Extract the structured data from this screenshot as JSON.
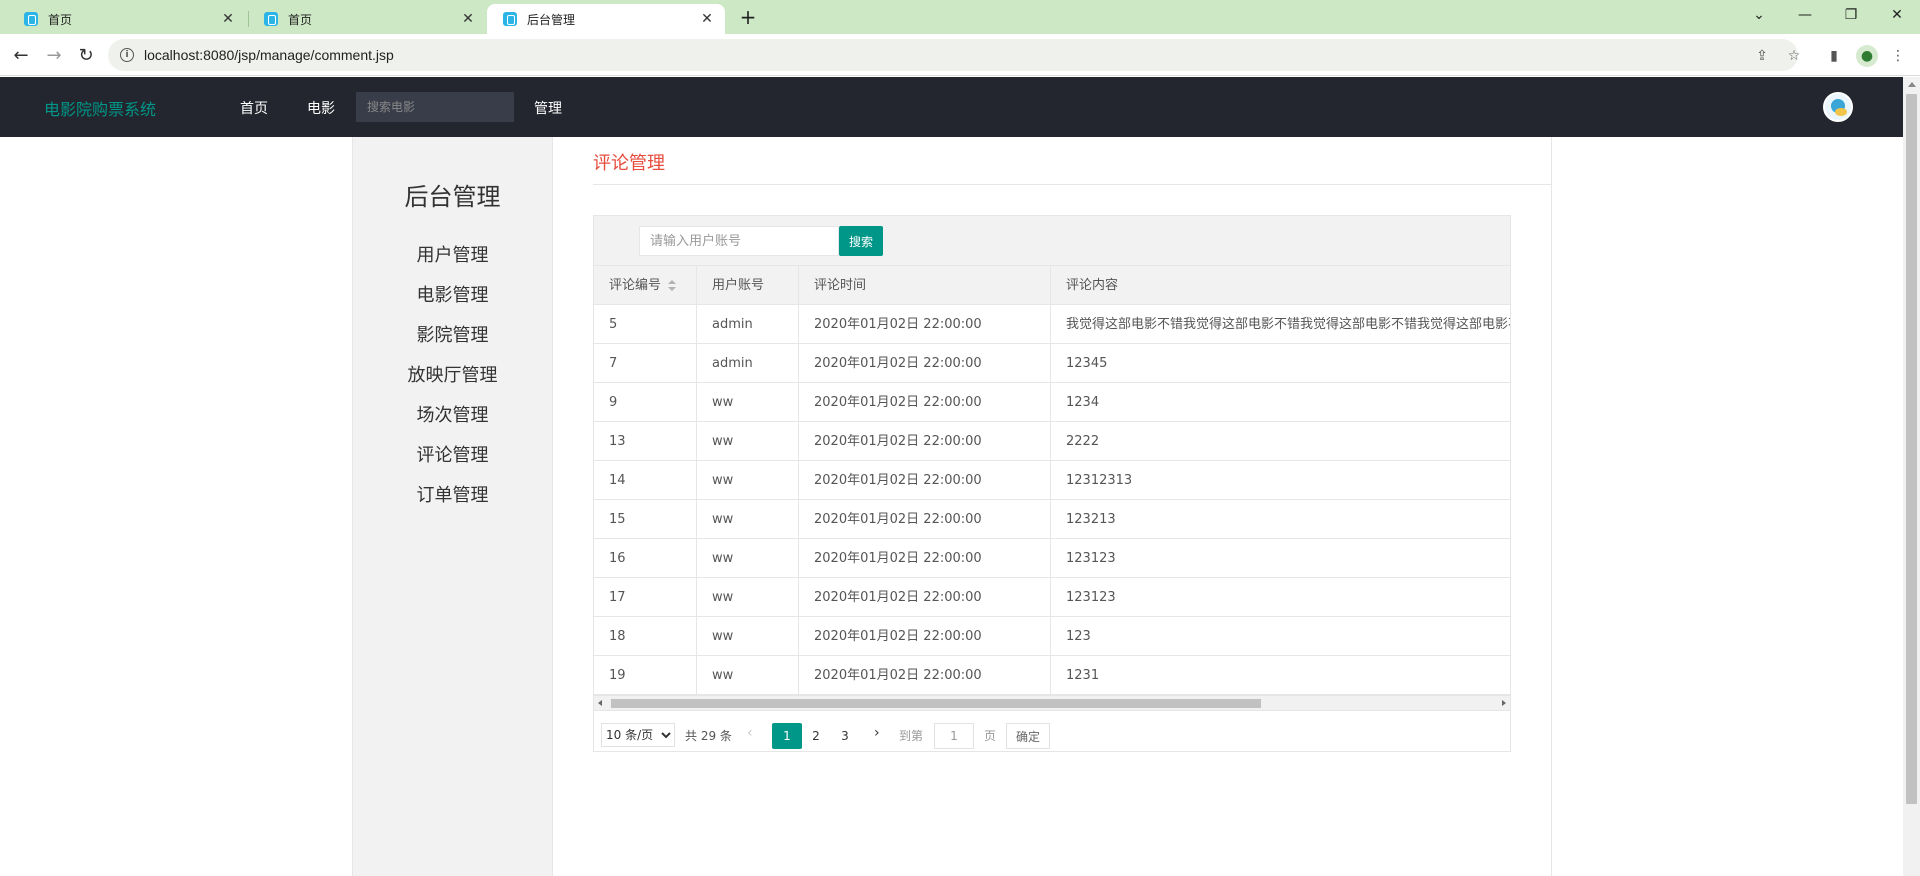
{
  "browser": {
    "tabs": [
      {
        "title": "首页"
      },
      {
        "title": "首页"
      },
      {
        "title": "后台管理"
      }
    ],
    "url": "localhost:8080/jsp/manage/comment.jsp"
  },
  "header": {
    "brand": "电影院购票系统",
    "nav": {
      "home": "首页",
      "movies": "电影",
      "manage": "管理"
    },
    "search_placeholder": "搜索电影"
  },
  "sidebar": {
    "title": "后台管理",
    "items": [
      {
        "label": "用户管理"
      },
      {
        "label": "电影管理"
      },
      {
        "label": "影院管理"
      },
      {
        "label": "放映厅管理"
      },
      {
        "label": "场次管理"
      },
      {
        "label": "评论管理"
      },
      {
        "label": "订单管理"
      }
    ]
  },
  "main": {
    "title": "评论管理",
    "search": {
      "placeholder": "请输入用户账号",
      "button": "搜索"
    },
    "table": {
      "columns": [
        "评论编号",
        "用户账号",
        "评论时间",
        "评论内容"
      ],
      "rows": [
        {
          "id": "5",
          "user": "admin",
          "time": "2020年01月02日 22:00:00",
          "content": "我觉得这部电影不错我觉得这部电影不错我觉得这部电影不错我觉得这部电影不错我觉得这部"
        },
        {
          "id": "7",
          "user": "admin",
          "time": "2020年01月02日 22:00:00",
          "content": "12345"
        },
        {
          "id": "9",
          "user": "ww",
          "time": "2020年01月02日 22:00:00",
          "content": "1234"
        },
        {
          "id": "13",
          "user": "ww",
          "time": "2020年01月02日 22:00:00",
          "content": "2222"
        },
        {
          "id": "14",
          "user": "ww",
          "time": "2020年01月02日 22:00:00",
          "content": "12312313"
        },
        {
          "id": "15",
          "user": "ww",
          "time": "2020年01月02日 22:00:00",
          "content": "123213"
        },
        {
          "id": "16",
          "user": "ww",
          "time": "2020年01月02日 22:00:00",
          "content": "123123"
        },
        {
          "id": "17",
          "user": "ww",
          "time": "2020年01月02日 22:00:00",
          "content": "123123"
        },
        {
          "id": "18",
          "user": "ww",
          "time": "2020年01月02日 22:00:00",
          "content": "123"
        },
        {
          "id": "19",
          "user": "ww",
          "time": "2020年01月02日 22:00:00",
          "content": "1231"
        }
      ]
    },
    "pager": {
      "page_size": "10 条/页",
      "total": "共 29 条",
      "pages": [
        "1",
        "2",
        "3"
      ],
      "current": "1",
      "goto_label": "到第",
      "goto_value": "1",
      "page_unit": "页",
      "confirm": "确定"
    }
  },
  "colors": {
    "accent": "#009688",
    "header_bg": "#23262e",
    "title_red": "#e74c3c"
  }
}
